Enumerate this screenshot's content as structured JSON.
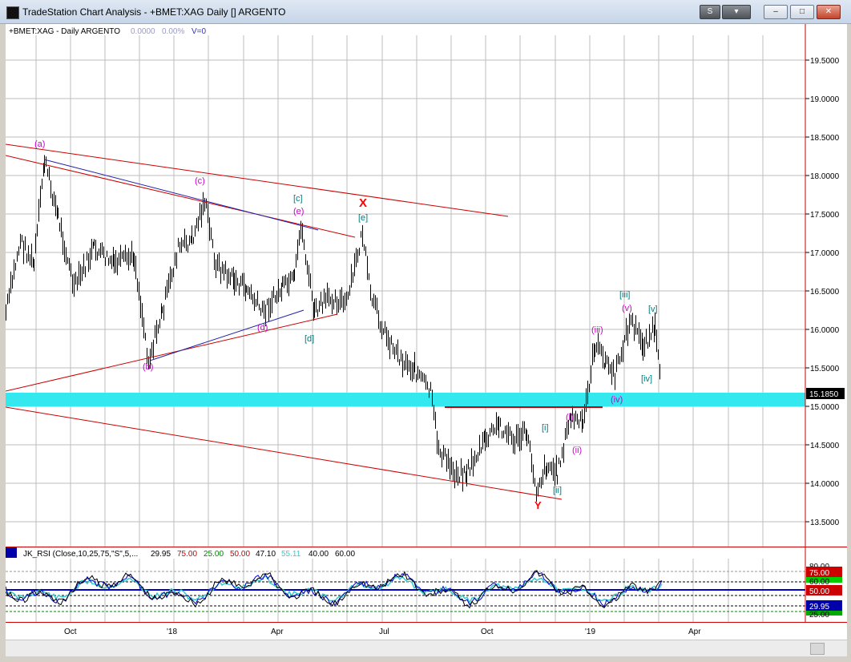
{
  "window": {
    "title": "TradeStation Chart Analysis - +BMET:XAG Daily [] ARGENTO",
    "controls": {
      "symbol_button": "S",
      "menu_button": "▾",
      "minimize": "–",
      "maximize": "□",
      "close": "✕"
    }
  },
  "chart_header": {
    "symbol": "+BMET:XAG - Daily  ARGENTO",
    "change": "0.0000",
    "pct_change": "0.00%",
    "volume": "V=0"
  },
  "price_axis": {
    "ticks": [
      "19.5000",
      "19.0000",
      "18.5000",
      "18.0000",
      "17.5000",
      "17.0000",
      "16.5000",
      "16.0000",
      "15.5000",
      "15.0000",
      "14.5000",
      "14.0000",
      "13.5000"
    ],
    "last_price": "15.1850"
  },
  "time_axis": {
    "labels": [
      "Oct",
      "'18",
      "Apr",
      "Jul",
      "Oct",
      "'19",
      "Apr"
    ]
  },
  "wave_labels": [
    {
      "text": "(a)",
      "color": "#cc00cc"
    },
    {
      "text": "(b)",
      "color": "#cc00cc"
    },
    {
      "text": "(c)",
      "color": "#cc00cc"
    },
    {
      "text": "(d)",
      "color": "#cc00cc"
    },
    {
      "text": "(e)",
      "color": "#cc00cc"
    },
    {
      "text": "[c]",
      "color": "#008080"
    },
    {
      "text": "[d]",
      "color": "#008080"
    },
    {
      "text": "[e]",
      "color": "#008080"
    },
    {
      "text": "X",
      "color": "#ff0000"
    },
    {
      "text": "Y",
      "color": "#ff0000"
    },
    {
      "text": "[i]",
      "color": "#008080"
    },
    {
      "text": "[ii]",
      "color": "#008080"
    },
    {
      "text": "[iii]",
      "color": "#008080"
    },
    {
      "text": "[iv]",
      "color": "#008080"
    },
    {
      "text": "[v]",
      "color": "#008080"
    },
    {
      "text": "(i)",
      "color": "#cc00cc"
    },
    {
      "text": "(ii)",
      "color": "#cc00cc"
    },
    {
      "text": "(iii)",
      "color": "#cc00cc"
    },
    {
      "text": "(iv)",
      "color": "#cc00cc"
    },
    {
      "text": "(v)",
      "color": "#cc00cc"
    }
  ],
  "rsi_header": {
    "name": "JK_RSI (Close,10,25,75,\"S\",5,...",
    "v1": "29.95",
    "v2": "75.00",
    "v3": "25.00",
    "v4": "50.00",
    "v5": "47.10",
    "v6": "55.11",
    "v7": "40.00",
    "v8": "60.00"
  },
  "rsi_axis": {
    "badge_top": "75.00",
    "badge_mid": "50.00",
    "badge_low": "29.95",
    "obscured_top": "80.00",
    "obscured_mid": "60.00",
    "obscured_low": "25.00"
  },
  "colors": {
    "support_band": "#33e8ee",
    "channel": "#c00000",
    "blue_trendline": "#2222aa",
    "bars": "#000000",
    "rsi_cyan": "#33cccc",
    "rsi_blue": "#0000cc"
  }
}
